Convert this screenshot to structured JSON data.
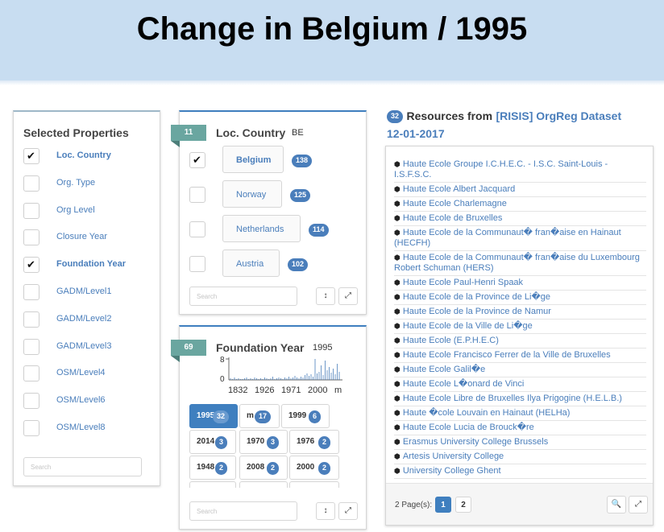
{
  "banner": {
    "title": "Change in Belgium / 1995"
  },
  "properties": {
    "title": "Selected Properties",
    "items": [
      {
        "label": "Loc. Country",
        "checked": true
      },
      {
        "label": "Org. Type",
        "checked": false
      },
      {
        "label": "Org Level",
        "checked": false
      },
      {
        "label": "Closure Year",
        "checked": false
      },
      {
        "label": "Foundation Year",
        "checked": true
      },
      {
        "label": "GADM/Level1",
        "checked": false
      },
      {
        "label": "GADM/Level2",
        "checked": false
      },
      {
        "label": "GADM/Level3",
        "checked": false
      },
      {
        "label": "OSM/Level4",
        "checked": false
      },
      {
        "label": "OSM/Level6",
        "checked": false
      },
      {
        "label": "OSM/Level8",
        "checked": false
      }
    ],
    "search_placeholder": "Search"
  },
  "loc_country": {
    "tag": "11",
    "title": "Loc. Country",
    "selected": "BE",
    "items": [
      {
        "label": "Belgium",
        "count": "138",
        "checked": true
      },
      {
        "label": "Norway",
        "count": "125",
        "checked": false
      },
      {
        "label": "Netherlands",
        "count": "114",
        "checked": false
      },
      {
        "label": "Austria",
        "count": "102",
        "checked": false
      }
    ],
    "search_placeholder": "Search",
    "sort_icon": "↕",
    "expand_icon": "⤢"
  },
  "foundation_year": {
    "tag": "69",
    "title": "Foundation Year",
    "selected": "1995",
    "histogram": {
      "y_ticks": [
        "8",
        "0"
      ],
      "x_ticks": [
        "1832",
        "1926",
        "1971",
        "2000",
        "m"
      ]
    },
    "buttons": [
      {
        "label": "1995",
        "count": "32",
        "selected": true
      },
      {
        "label": "m",
        "count": "17",
        "selected": false
      },
      {
        "label": "1999",
        "count": "6",
        "selected": false
      },
      {
        "label": "2014",
        "count": "3",
        "selected": false
      },
      {
        "label": "1970",
        "count": "3",
        "selected": false
      },
      {
        "label": "1976",
        "count": "2",
        "selected": false
      },
      {
        "label": "1948",
        "count": "2",
        "selected": false
      },
      {
        "label": "2008",
        "count": "2",
        "selected": false
      },
      {
        "label": "2000",
        "count": "2",
        "selected": false
      }
    ],
    "search_placeholder": "Search",
    "sort_icon": "↕",
    "expand_icon": "⤢"
  },
  "resources": {
    "count": "32",
    "title_prefix": "Resources from",
    "dataset_link": "[RISIS] OrgReg Dataset",
    "date": "12-01-2017",
    "items": [
      "Haute Ecole Groupe I.C.H.E.C. - I.S.C. Saint-Louis - I.S.F.S.C.",
      "Haute Ecole Albert Jacquard",
      "Haute Ecole Charlemagne",
      "Haute Ecole de Bruxelles",
      "Haute Ecole de la Communaut� fran�aise en Hainaut (HECFH)",
      "Haute Ecole de la Communaut� fran�aise du Luxembourg Robert Schuman (HERS)",
      "Haute Ecole Paul-Henri Spaak",
      "Haute Ecole de la Province de Li�ge",
      "Haute Ecole de la Province de Namur",
      "Haute Ecole de la Ville de Li�ge",
      "Haute Ecole (E.P.H.E.C)",
      "Haute Ecole Francisco Ferrer de la Ville de Bruxelles",
      "Haute Ecole Galil�e",
      "Haute Ecole L�onard de Vinci",
      "Haute Ecole Libre de Bruxelles Ilya Prigogine (H.E.L.B.)",
      "Haute �cole Louvain en Hainaut (HELHa)",
      "Haute Ecole Lucia de Brouck�re",
      "Erasmus University College Brussels",
      "Artesis University College",
      "University College Ghent"
    ],
    "pages_label": "2 Page(s):",
    "pages": [
      "1",
      "2"
    ],
    "item_icon": "cube-icon",
    "search_icon": "🔍",
    "expand_icon": "⤢"
  }
}
